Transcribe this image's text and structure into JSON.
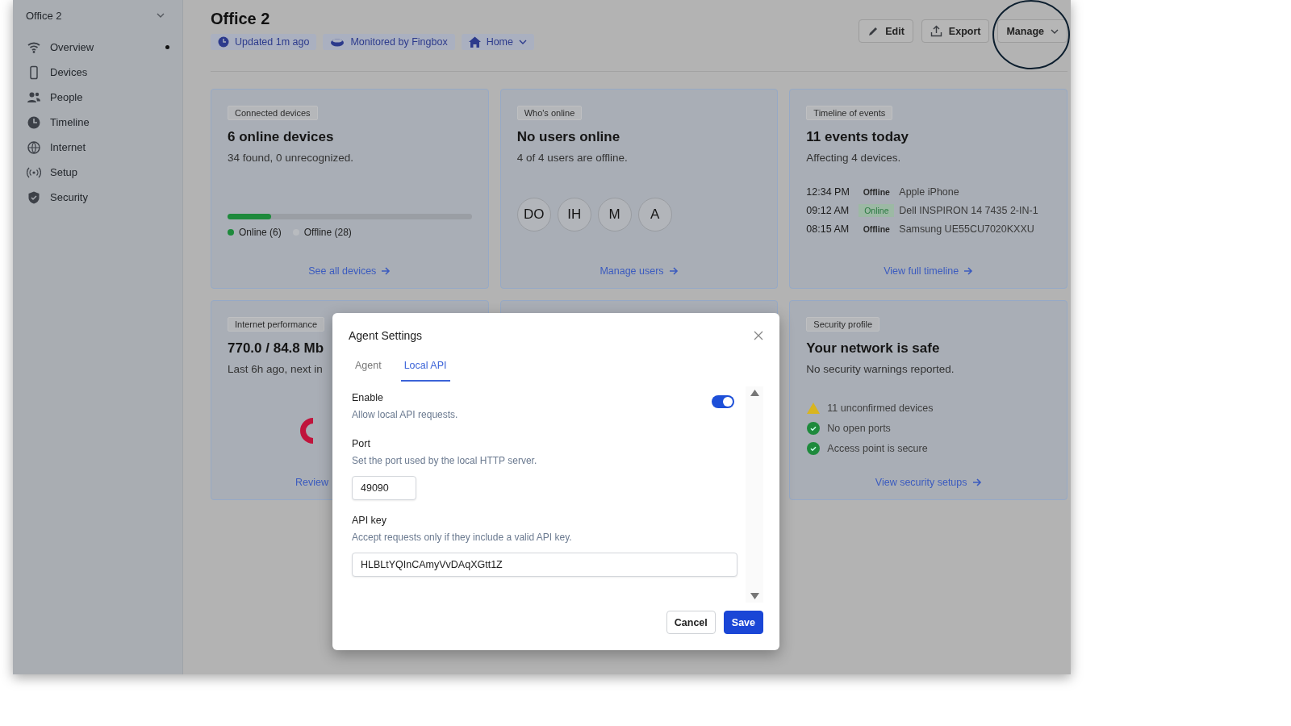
{
  "sidebar": {
    "workspace": "Office 2",
    "items": [
      {
        "label": "Overview",
        "selected": true
      },
      {
        "label": "Devices",
        "selected": false
      },
      {
        "label": "People",
        "selected": false
      },
      {
        "label": "Timeline",
        "selected": false
      },
      {
        "label": "Internet",
        "selected": false
      },
      {
        "label": "Setup",
        "selected": false
      },
      {
        "label": "Security",
        "selected": false
      }
    ]
  },
  "header": {
    "title": "Office 2",
    "chips": [
      {
        "label": "Updated 1m ago",
        "dropdown": false
      },
      {
        "label": "Monitored by Fingbox",
        "dropdown": false
      },
      {
        "label": "Home",
        "dropdown": true
      }
    ],
    "buttons": [
      {
        "label": "Edit"
      },
      {
        "label": "Export"
      },
      {
        "label": "Manage"
      }
    ]
  },
  "cards": [
    {
      "kind": "devices",
      "tag": "Connected devices",
      "title": "6 online devices",
      "subtitle": "34 found, 0 unrecognized.",
      "level": 0.18,
      "legend": [
        {
          "label": "Online (6)",
          "color": "#1e8a3c"
        },
        {
          "label": "Offline (28)",
          "color": "#b8bbbf"
        }
      ],
      "link": "See all devices"
    },
    {
      "kind": "users",
      "tag": "Who's online",
      "title": "No users online",
      "subtitle": "4 of 4 users are offline.",
      "avatars": [
        "DO",
        "IH",
        "M",
        "A"
      ],
      "link": "Manage users"
    },
    {
      "kind": "timeline",
      "tag": "Timeline of events",
      "title": "11 events today",
      "subtitle": "Affecting 4 devices.",
      "events": [
        {
          "time": "12:34 PM",
          "status": "Offline",
          "online": false,
          "device": "Apple iPhone"
        },
        {
          "time": "09:12 AM",
          "status": "Online",
          "online": true,
          "device": "Dell INSPIRON 14 7435 2-IN-1"
        },
        {
          "time": "08:15 AM",
          "status": "Offline",
          "online": false,
          "device": "Samsung UE55CU7020KXXU"
        }
      ],
      "link": "View full timeline"
    },
    {
      "kind": "internet",
      "tag": "Internet performance",
      "title": "770.0 / 84.8 Mb",
      "subtitle": "Last 6h ago, next in",
      "link": "Review"
    },
    {
      "kind": "blank"
    },
    {
      "kind": "security",
      "tag": "Security profile",
      "title": "Your network is safe",
      "subtitle": "No security warnings reported.",
      "checks": [
        {
          "kind": "warning",
          "label": "11 unconfirmed devices"
        },
        {
          "kind": "ok",
          "label": "No open ports"
        },
        {
          "kind": "ok",
          "label": "Access point is secure"
        }
      ],
      "link": "View security setups"
    }
  ],
  "modal": {
    "title": "Agent Settings",
    "tabs": [
      {
        "label": "Agent",
        "selected": false
      },
      {
        "label": "Local API",
        "selected": true
      }
    ],
    "enable": {
      "label": "Enable",
      "hint": "Allow local API requests.",
      "on": true
    },
    "port": {
      "label": "Port",
      "hint": "Set the port used by the local HTTP server.",
      "value": "49090"
    },
    "api_key": {
      "label": "API key",
      "hint": "Accept requests only if they include a valid API key.",
      "value": "HLBLtYQInCAmyVvDAqXGtt1Z"
    },
    "buttons": [
      {
        "kind": "secondary",
        "label": "Cancel"
      },
      {
        "kind": "primary",
        "label": "Save"
      }
    ]
  }
}
